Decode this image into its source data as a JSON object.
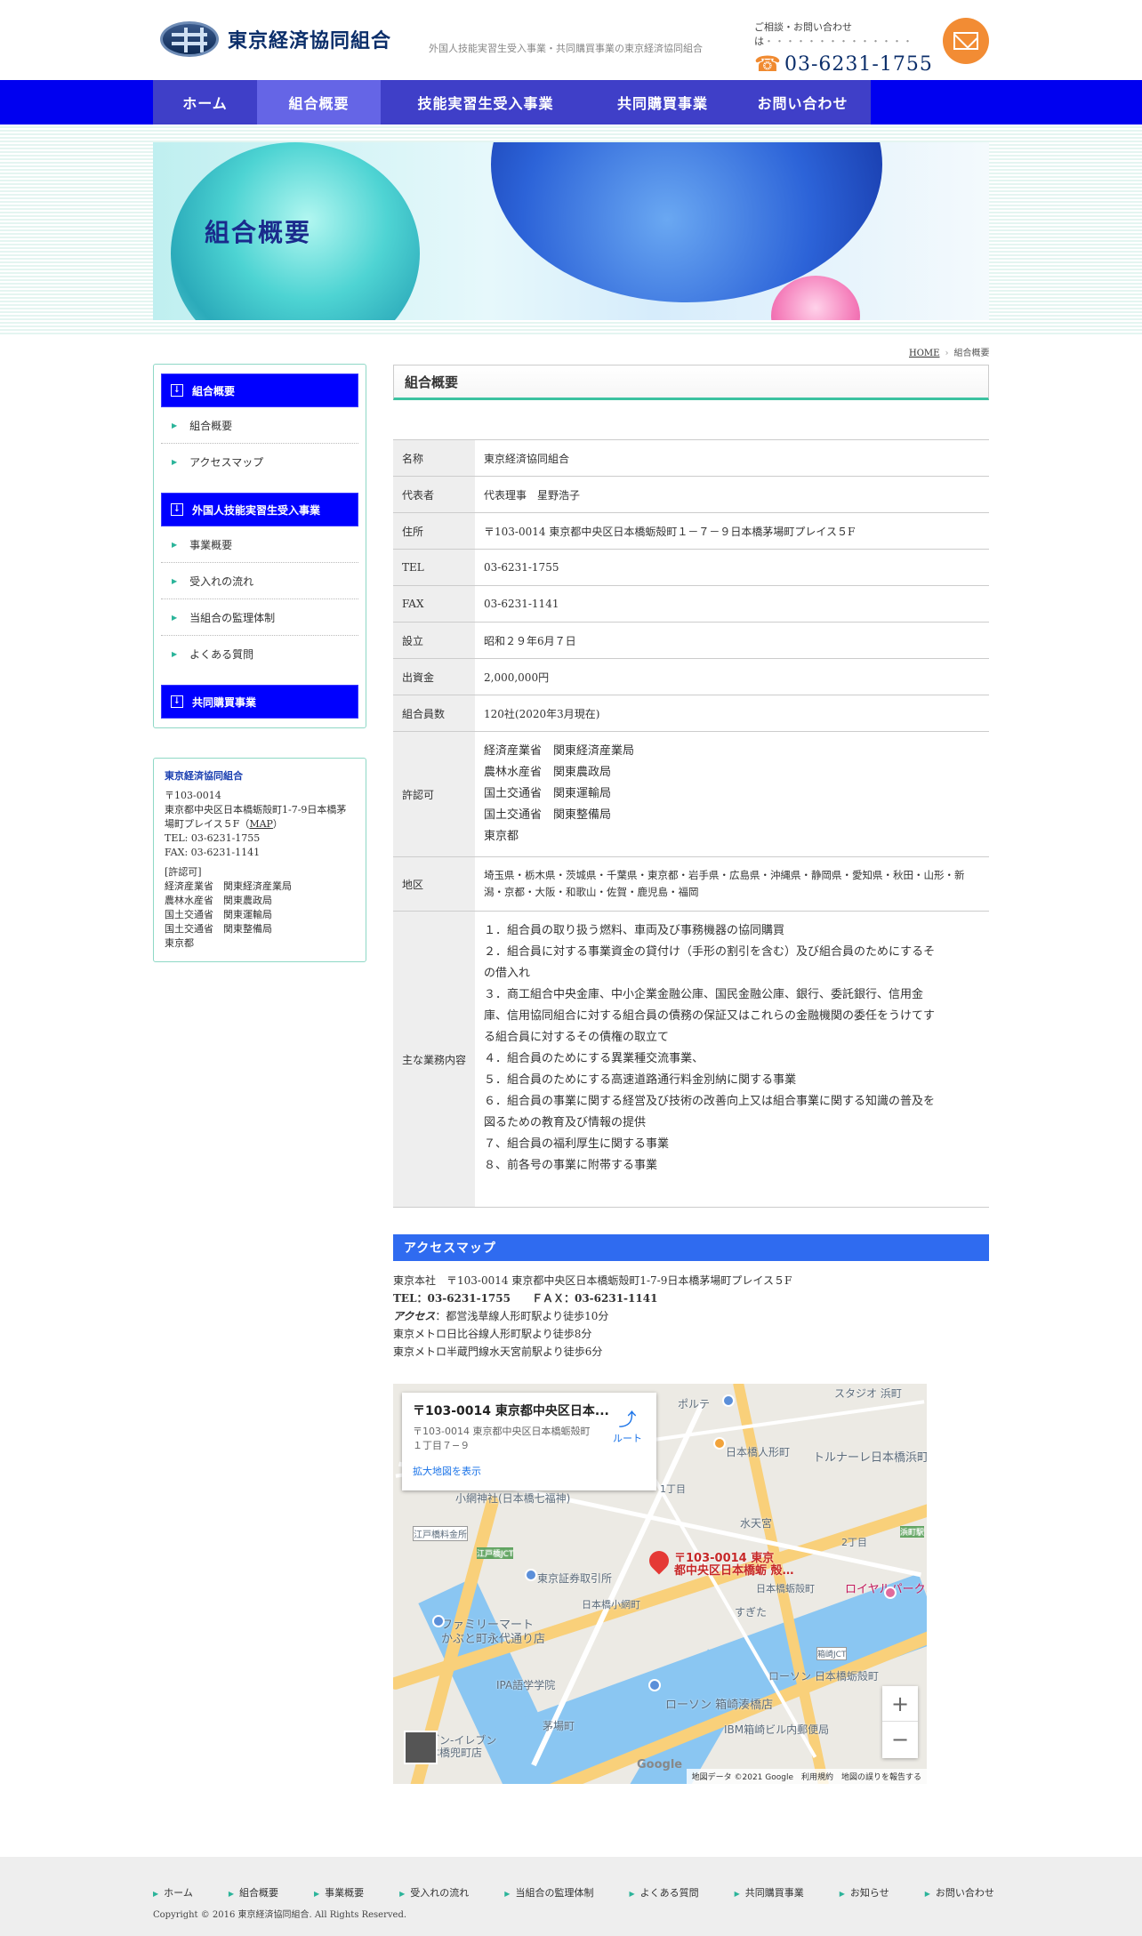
{
  "header": {
    "org_name": "東京経済協同組合",
    "tagline": "外国人技能実習生受入事業・共同購買事業の東京経済協同組合",
    "contact_lead": "ご相談・お問い合わせは",
    "contact_dots": "・・・・・・・・・・・・・・",
    "phone": "03-6231-1755"
  },
  "nav": [
    {
      "label": "ホーム"
    },
    {
      "label": "組合概要"
    },
    {
      "label": "技能実習生受入事業"
    },
    {
      "label": "共同購買事業"
    },
    {
      "label": "お問い合わせ"
    }
  ],
  "hero": {
    "title": "組合概要"
  },
  "breadcrumb": {
    "home": "HOME",
    "current": "組合概要"
  },
  "sidebar": {
    "sections": [
      {
        "title": "組合概要",
        "items": [
          "組合概要",
          "アクセスマップ"
        ]
      },
      {
        "title": "外国人技能実習生受入事業",
        "items": [
          "事業概要",
          "受入れの流れ",
          "当組合の監理体制",
          "よくある質問"
        ]
      },
      {
        "title": "共同購買事業",
        "items": []
      }
    ],
    "info": {
      "name": "東京経済協同組合",
      "postal": "〒103-0014",
      "address": "東京都中央区日本橋蛎殻町1-7-9日本橋茅場町プレイス５F",
      "map_link": "MAP",
      "tel": "TEL: 03-6231-1755",
      "fax": "FAX: 03-6231-1141",
      "license_head": "[許認可]",
      "licenses": [
        "経済産業省　関東経済産業局",
        "農林水産省　関東農政局",
        "国土交通省　関東運輸局",
        "国土交通省　関東整備局",
        "東京都"
      ]
    }
  },
  "main": {
    "title": "組合概要",
    "rows": [
      {
        "th": "名称",
        "td": "東京経済協同組合"
      },
      {
        "th": "代表者",
        "td": "代表理事　星野浩子"
      },
      {
        "th": "住所",
        "td": "〒103-0014 東京都中央区日本橋蛎殻町１－７－９日本橋茅場町プレイス５F"
      },
      {
        "th": "TEL",
        "td": "03-6231-1755"
      },
      {
        "th": "FAX",
        "td": "03-6231-1141"
      },
      {
        "th": "設立",
        "td": "昭和２９年6月７日"
      },
      {
        "th": "出資金",
        "td": "2,000,000円"
      },
      {
        "th": "組合員数",
        "td": "120社(2020年3月現在)"
      }
    ],
    "license_label": "許認可",
    "license_lines": [
      "経済産業省　関東経済産業局",
      "農林水産省　関東農政局",
      "国土交通省　関東運輸局",
      "国土交通省　関東整備局",
      "東京都"
    ],
    "region_label": "地区",
    "region": "埼玉県・栃木県・茨城県・千葉県・東京都・岩手県・広島県・沖縄県・静岡県・愛知県・秋田・山形・新潟・京都・大阪・和歌山・佐賀・鹿児島・福岡",
    "business_label": "主な業務内容",
    "business_lines": [
      "１．組合員の取り扱う燃料、車両及び事務機器の協同購買",
      "２．組合員に対する事業資金の貸付け（手形の割引を含む）及び組合員のためにするそ",
      "の借入れ",
      "３．商工組合中央金庫、中小企業金融公庫、国民金融公庫、銀行、委託銀行、信用金",
      "庫、信用協同組合に対する組合員の債務の保証又はこれらの金融機関の委任をうけてす",
      "る組合員に対するその債権の取立て",
      "４．組合員のためにする異業種交流事業、",
      "５．組合員のためにする高速道路通行料金別納に関する事業",
      "６．組合員の事業に関する経営及び技術の改善向上又は組合事業に関する知識の普及を",
      "図るための教育及び情報の提供",
      "７、組合員の福利厚生に関する事業",
      "８、前各号の事業に附帯する事業"
    ]
  },
  "access": {
    "title": "アクセスマップ",
    "hq": "東京本社　〒103-0014 東京都中央区日本橋蛎殻町1-7-9日本橋茅場町プレイス５F",
    "telfax": "TEL：03-6231-1755　　ＦＡＸ：03-6231-1141",
    "access_label": "アクセス",
    "access_lines": [
      "：都営浅草線人形町駅より徒歩10分",
      "東京メトロ日比谷線人形町駅より徒歩8分",
      "東京メトロ半蔵門線水天宮前駅より徒歩6分"
    ]
  },
  "map": {
    "card_title": "〒103-0014 東京都中央区日本...",
    "card_address": "〒103-0014 東京都中央区日本橋蛎殻町１丁目７−９",
    "card_link": "拡大地図を表示",
    "route": "ルート",
    "pin_label_1": "〒103-0014 東京",
    "pin_label_2": "都中央区日本橋蛎 殻…",
    "labels": [
      "日本橋人形町",
      "水天宮",
      "東京証券取引所",
      "日本橋小網町",
      "ファミリーマート",
      "かぶと町永代通り店",
      "IPA語学学院",
      "茅場町",
      "ローソン 箱崎湊橋店",
      "IBM箱崎ビル内郵便局",
      "日本橋蛎殻町",
      "すぎた",
      "トルナーレ日本橋浜町",
      "ロイヤルパークホテル",
      "小網神社(日本橋七福神)",
      "江戸橋料金所",
      "セブン-イレブン",
      "日本橋兜町店",
      "スタジオ 浜町",
      "ローソン 日本橋蛎殻町",
      "ポルテ",
      "箱崎JCT",
      "江戸橋JCT",
      "2丁目",
      "1丁目",
      "浜町駅"
    ],
    "zoom_in": "+",
    "zoom_out": "−",
    "google": "Google",
    "footer": "地図データ ©2021 Google　利用規約　地図の誤りを報告する"
  },
  "footer": {
    "links": [
      "ホーム",
      "組合概要",
      "事業概要",
      "受入れの流れ",
      "当組合の監理体制",
      "よくある質問",
      "共同購買事業",
      "お知らせ",
      "お問い合わせ"
    ],
    "copyright": "Copyright © 2016 東京経済協同組合. All Rights Reserved."
  },
  "colors": {
    "nav": "#0000f0",
    "accent": "#3cc2a0",
    "access_bar": "#2f6bf0",
    "phone_icon": "#f08a30"
  }
}
